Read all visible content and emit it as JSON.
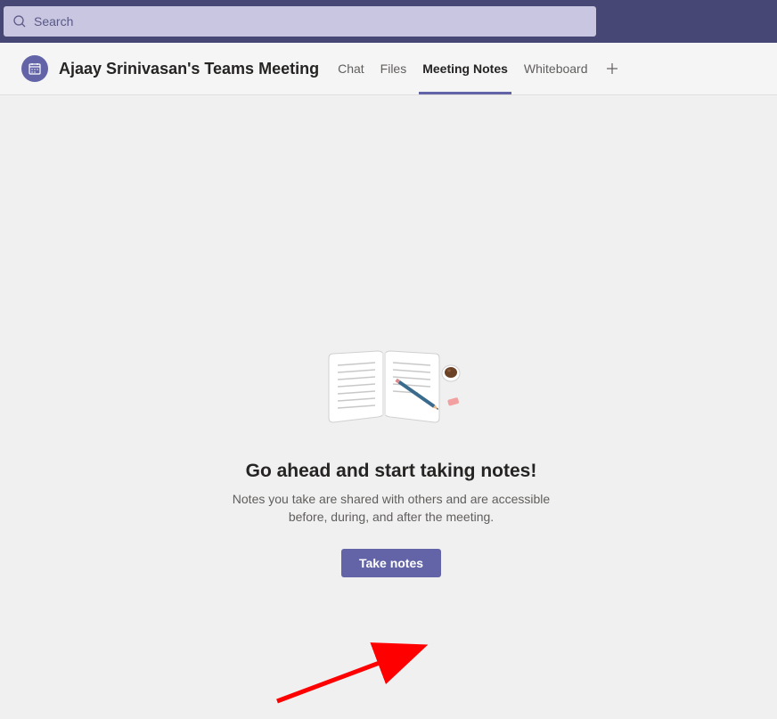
{
  "search": {
    "placeholder": "Search"
  },
  "header": {
    "title": "Ajaay Srinivasan's Teams Meeting",
    "tabs": [
      {
        "label": "Chat",
        "active": false
      },
      {
        "label": "Files",
        "active": false
      },
      {
        "label": "Meeting Notes",
        "active": true
      },
      {
        "label": "Whiteboard",
        "active": false
      }
    ]
  },
  "emptyState": {
    "heading": "Go ahead and start taking notes!",
    "subtext": "Notes you take are shared with others and are accessible before, during, and after the meeting.",
    "buttonLabel": "Take notes"
  },
  "colors": {
    "brand": "#6264a7",
    "topBar": "#464775"
  }
}
